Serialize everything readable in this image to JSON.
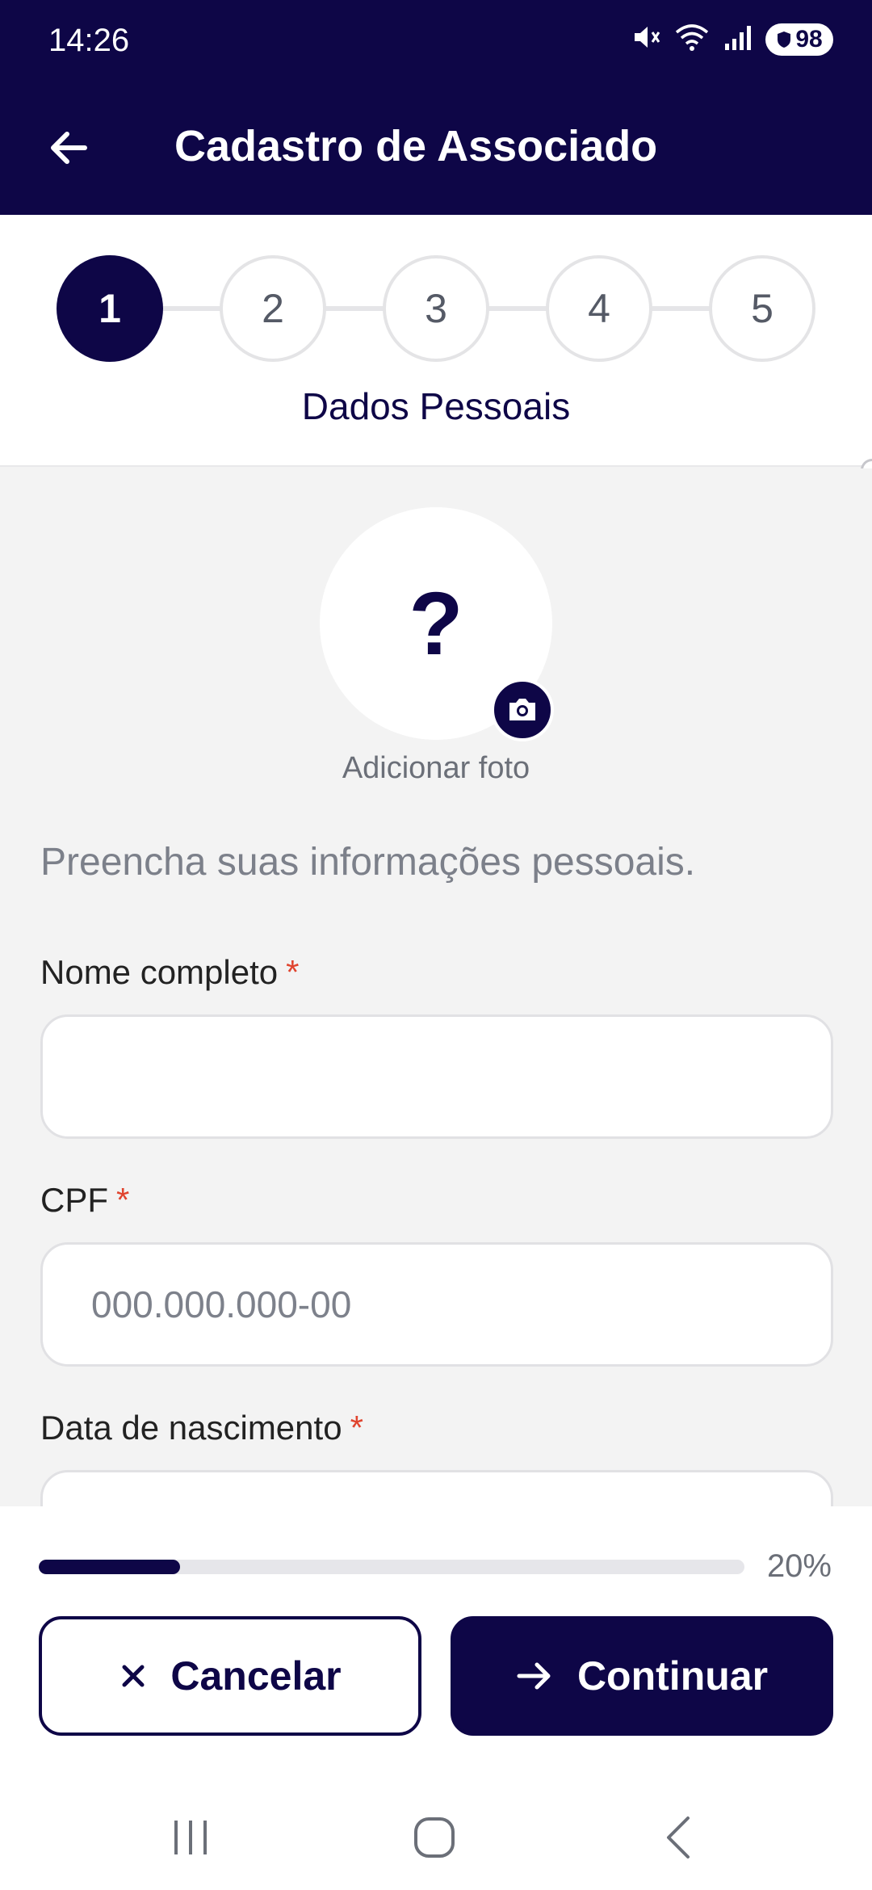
{
  "status_bar": {
    "time": "14:26",
    "battery": "98",
    "icons": [
      "mute-icon",
      "wifi-icon",
      "signal-icon",
      "battery-icon"
    ]
  },
  "app_bar": {
    "title": "Cadastro de Associado",
    "back_icon": "arrow-left-icon"
  },
  "stepper": {
    "steps": [
      "1",
      "2",
      "3",
      "4",
      "5"
    ],
    "active_step": 1,
    "current_label": "Dados Pessoais"
  },
  "photo": {
    "placeholder_glyph": "?",
    "add_label": "Adicionar foto",
    "camera_icon": "camera-icon"
  },
  "form": {
    "intro": "Preencha suas informações pessoais.",
    "required_marker": "*",
    "fields": [
      {
        "label": "Nome completo",
        "value": "",
        "placeholder": ""
      },
      {
        "label": "CPF",
        "value": "",
        "placeholder": "000.000.000-00"
      },
      {
        "label": "Data de nascimento",
        "value": "",
        "placeholder": ""
      }
    ]
  },
  "progress": {
    "percent": 20,
    "text": "20%"
  },
  "actions": {
    "cancel_label": "Cancelar",
    "continue_label": "Continuar"
  },
  "colors": {
    "primary": "#0e0647",
    "required": "#e0442e",
    "background": "#f3f3f3"
  }
}
